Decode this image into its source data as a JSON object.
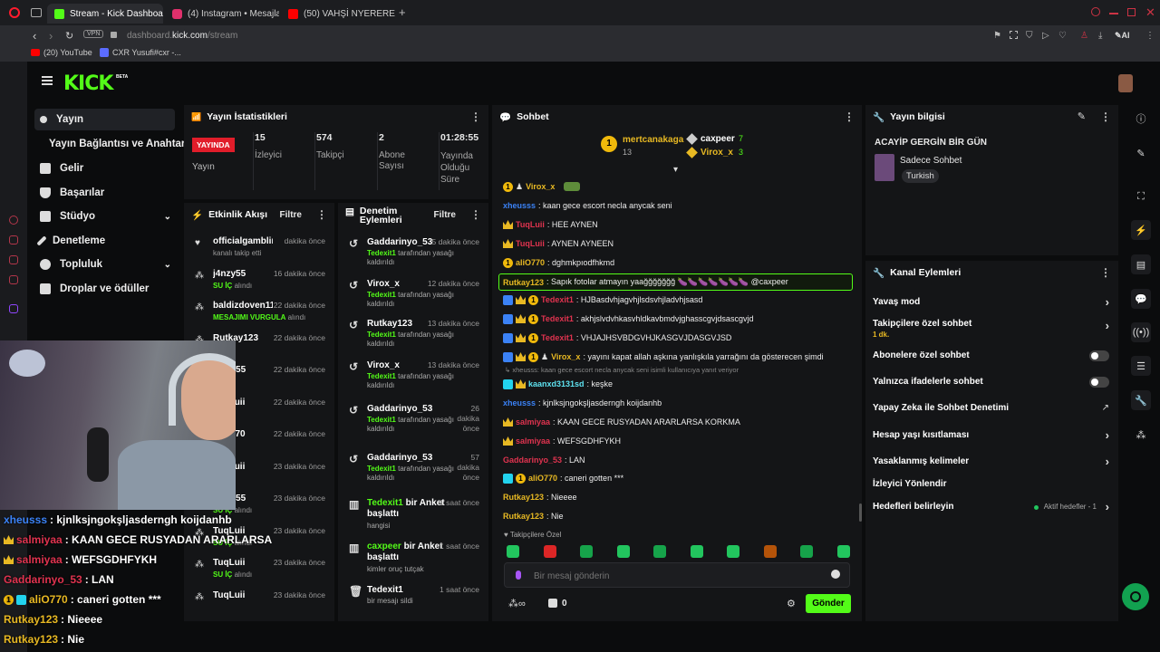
{
  "browser": {
    "tabs": [
      {
        "label": "Stream - Kick Dashboard",
        "color": "#53fc18"
      },
      {
        "label": "(4) Instagram • Mesajlar",
        "color": "#e1306c"
      },
      {
        "label": "(50) VAHŞİ NYERERE | En",
        "color": "#ff0000"
      }
    ],
    "vpn": "VPN",
    "url_host": "dashboard.",
    "url_domain": "kick.com",
    "url_path": "/stream",
    "ai_label": "AI",
    "bookmarks": [
      {
        "label": "(20) YouTube",
        "color": "#ff0000"
      },
      {
        "label": "CXR Yusufi#cxr -...",
        "color": "#5b6cff"
      }
    ]
  },
  "brand": {
    "logo": "KICK",
    "beta": "BETA"
  },
  "sidebar": {
    "items": [
      {
        "label": "Yayın",
        "icon": "broadcast-icon"
      },
      {
        "label": "Yayın Bağlantısı ve Anahtarı",
        "icon": ""
      },
      {
        "label": "Gelir",
        "icon": "chart-icon"
      },
      {
        "label": "Başarılar",
        "icon": "trophy-icon"
      },
      {
        "label": "Stüdyo",
        "icon": "studio-icon"
      },
      {
        "label": "Denetleme",
        "icon": "wrench-icon"
      },
      {
        "label": "Topluluk",
        "icon": "users-icon"
      },
      {
        "label": "Droplar ve ödüller",
        "icon": "gift-icon"
      }
    ]
  },
  "stats": {
    "title": "Yayın İstatistikleri",
    "live_badge": "YAYINDA",
    "live_label": "Yayın",
    "items": [
      {
        "value": "15",
        "label": "İzleyici"
      },
      {
        "value": "574",
        "label": "Takipçi"
      },
      {
        "value": "2",
        "label": "Abone Sayısı"
      },
      {
        "value": "01:28:55",
        "label": "Yayında Olduğu Süre"
      }
    ]
  },
  "activity": {
    "title": "Etkinlik Akışı",
    "filter": "Filtre",
    "items": [
      {
        "user": "officialgamblingacademy",
        "sub": "kanalı takip etti",
        "sub_green": "",
        "time": "dakika önce"
      },
      {
        "user": "j4nzy55",
        "sub": " alındı",
        "sub_green": "SU İÇ",
        "time": "16 dakika önce"
      },
      {
        "user": "baldizdoven11",
        "sub": " alındı",
        "sub_green": "MESAJIMI VURGULA",
        "time": "22 dakika önce"
      },
      {
        "user": "Rutkay123",
        "sub": "",
        "sub_green": "",
        "time": "22 dakika önce"
      },
      {
        "user": "j4nzy55",
        "sub": "",
        "sub_green": "",
        "time": "22 dakika önce"
      },
      {
        "user": "TuqLuii",
        "sub": "",
        "sub_green": "",
        "time": "22 dakika önce"
      },
      {
        "user": "aliO770",
        "sub": "",
        "sub_green": "",
        "time": "22 dakika önce"
      },
      {
        "user": "TuqLuii",
        "sub": "",
        "sub_green": "",
        "time": "23 dakika önce"
      },
      {
        "user": "j4nzy55",
        "sub": " alındı",
        "sub_green": "SU İÇ",
        "time": "23 dakika önce"
      },
      {
        "user": "TuqLuii",
        "sub": " alındı",
        "sub_green": "SU İÇ",
        "time": "23 dakika önce"
      },
      {
        "user": "TuqLuii",
        "sub": " alındı",
        "sub_green": "SU İÇ",
        "time": "23 dakika önce"
      },
      {
        "user": "TuqLuii",
        "sub": "",
        "sub_green": "",
        "time": "23 dakika önce"
      }
    ]
  },
  "moderation": {
    "title": "Denetim Eylemleri",
    "filter": "Filtre",
    "items": [
      {
        "user": "Gaddarinyo_53",
        "time": "5 dakika önce",
        "actor": "Tedexit1",
        "text": " tarafından yasağı kaldırıldı",
        "icon": "undo-icon"
      },
      {
        "user": "Virox_x",
        "time": "12 dakika önce",
        "actor": "Tedexit1",
        "text": " tarafından yasağı kaldırıldı",
        "icon": "undo-icon"
      },
      {
        "user": "Rutkay123",
        "time": "13 dakika önce",
        "actor": "Tedexit1",
        "text": " tarafından yasağı kaldırıldı",
        "icon": "undo-icon"
      },
      {
        "user": "Virox_x",
        "time": "13 dakika önce",
        "actor": "Tedexit1",
        "text": " tarafından yasağı kaldırıldı",
        "icon": "undo-icon"
      },
      {
        "user": "Gaddarinyo_53",
        "time": "26 dakika önce",
        "actor": "Tedexit1",
        "text": " tarafından yasağı kaldırıldı",
        "icon": "undo-icon"
      },
      {
        "user": "Gaddarinyo_53",
        "time": "57 dakika önce",
        "actor": "Tedexit1",
        "text": " tarafından yasağı kaldırıldı",
        "icon": "undo-icon"
      },
      {
        "user": "Tedexit1",
        "user_suffix": " bir Anket başlattı",
        "time": "1 saat önce",
        "actor": "",
        "text": "hangisi",
        "icon": "poll-icon"
      },
      {
        "user": "caxpeer",
        "user_suffix": " bir Anket başlattı",
        "time": "1 saat önce",
        "actor": "",
        "text": "kimler oruç tutçak",
        "icon": "poll-icon"
      },
      {
        "user": "Tedexit1",
        "time": "1 saat önce",
        "actor": "",
        "text": "bir mesajı sildi",
        "icon": "trash-icon"
      }
    ]
  },
  "chat": {
    "title": "Sohbet",
    "leaders": {
      "first": {
        "name": "mertcanakaga",
        "count": "13"
      },
      "second": {
        "name": "caxpeer",
        "count": "7"
      },
      "third": {
        "name": "Virox_x",
        "count": "3"
      }
    },
    "messages": [
      {
        "user": "Virox_x",
        "color": "#e8b923",
        "text": "",
        "badges": [
          "coin",
          "user"
        ],
        "emote": true
      },
      {
        "user": "xheusss",
        "color": "#3b82f6",
        "text": ": kaan gece escort necla anycak seni",
        "badges": []
      },
      {
        "user": "TuqLuii",
        "color": "#e0334f",
        "text": ": HEE AYNEN",
        "badges": [
          "crown"
        ]
      },
      {
        "user": "TuqLuii",
        "color": "#e0334f",
        "text": ": AYNEN AYNEEN",
        "badges": [
          "crown"
        ]
      },
      {
        "user": "aliO770",
        "color": "#e8b923",
        "text": ": dghmkpıodfhkmd",
        "badges": [
          "coin"
        ]
      },
      {
        "user": "Rutkay123",
        "color": "#e8b923",
        "text": ": Sapık fotolar atmayın yaağğğğğğğ 🍆🍆🍆🍆🍆🍆🍆 @caxpeer",
        "badges": [],
        "highlight": true
      },
      {
        "user": "Tedexit1",
        "color": "#e0334f",
        "text": ": HJBasdvhjagvhjlsdsvhjladvhjsasd",
        "badges": [
          "swords",
          "crown",
          "coin"
        ]
      },
      {
        "user": "Tedexit1",
        "color": "#e0334f",
        "text": ": akhjslvdvhkasvhldkavbmdvjghasscgvjdsascgvjd",
        "badges": [
          "swords",
          "crown",
          "coin"
        ]
      },
      {
        "user": "Tedexit1",
        "color": "#e0334f",
        "text": ": VHJAJHSVBDGVHJKASGVJDASGVJSD",
        "badges": [
          "swords",
          "crown",
          "coin"
        ]
      },
      {
        "user": "Virox_x",
        "color": "#e8b923",
        "text": ": yayını kapat allah aşkına yanlışkıla yarrağını da gösterecen şimdi",
        "badges": [
          "swords",
          "crown",
          "coin",
          "user"
        ]
      },
      {
        "user": "kaanxd3131sd",
        "color": "#5ee2f0",
        "text": ": keşke",
        "badges": [
          "teal",
          "crown"
        ],
        "reply": "↳ xheusss: kaan gece escort necla anycak seni isimli kullanıcıya yanıt veriyor"
      },
      {
        "user": "xheusss",
        "color": "#3b82f6",
        "text": ": kjnlksjngokşljasderngh koijdanhb",
        "badges": []
      },
      {
        "user": "salmiyaa",
        "color": "#e0334f",
        "text": ": KAAN GECE RUSYADAN ARARLARSA KORKMA",
        "badges": [
          "crown"
        ]
      },
      {
        "user": "salmiyaa",
        "color": "#e0334f",
        "text": ": WEFSGDHFYKH",
        "badges": [
          "crown"
        ]
      },
      {
        "user": "Gaddarinyo_53",
        "color": "#e0334f",
        "text": ": LAN",
        "badges": []
      },
      {
        "user": "aliO770",
        "color": "#e8b923",
        "text": ": caneri gotten ***",
        "badges": [
          "teal",
          "coin"
        ]
      },
      {
        "user": "Rutkay123",
        "color": "#e8b923",
        "text": ": Nieeee",
        "badges": []
      },
      {
        "user": "Rutkay123",
        "color": "#e8b923",
        "text": ": Nie",
        "badges": []
      }
    ],
    "followers_only": "Takipçilere Özel",
    "emote_colors": [
      "#22c55e",
      "#dc2626",
      "#16a34a",
      "#22c55e",
      "#16a34a",
      "#22c55e",
      "#22c55e",
      "#b45309",
      "#16a34a",
      "#22c55e"
    ],
    "input_placeholder": "Bir mesaj gönderin",
    "points": "0",
    "send": "Gönder"
  },
  "stream_info": {
    "title": "Yayın bilgisi",
    "stream_title": "ACAYİP GERGİN BİR GÜN",
    "category": "Sadece Sohbet",
    "language": "Turkish"
  },
  "channel_actions": {
    "title": "Kanal Eylemleri",
    "items": [
      {
        "label": "Yavaş mod",
        "control": "chevron"
      },
      {
        "label": "Takipçilere özel sohbet",
        "sub": "1 dk.",
        "control": "chevron"
      },
      {
        "label": "Abonelere özel sohbet",
        "control": "toggle"
      },
      {
        "label": "Yalnızca ifadelerle sohbet",
        "control": "toggle"
      },
      {
        "label": "Yapay Zeka ile Sohbet Denetimi",
        "control": "external"
      },
      {
        "label": "Hesap yaşı kısıtlaması",
        "control": "chevron"
      },
      {
        "label": "Yasaklanmış kelimeler",
        "control": "chevron"
      },
      {
        "label": "İzleyici Yönlendir",
        "control": "none"
      },
      {
        "label": "Hedefleri belirleyin",
        "control": "chevron",
        "extra": "Aktif hedefler - 1"
      }
    ]
  },
  "overlay_chat": [
    {
      "user": "xheusss",
      "color": "#3b82f6",
      "text": ": kjnlksjngokşljasderngh koijdanhb",
      "badges": []
    },
    {
      "user": "salmiyaa",
      "color": "#e0334f",
      "text": ": KAAN GECE RUSYADAN ARARLARSA",
      "badges": [
        "crown"
      ]
    },
    {
      "user": "salmiyaa",
      "color": "#e0334f",
      "text": ": WEFSGDHFYKH",
      "badges": [
        "crown"
      ]
    },
    {
      "user": "Gaddarinyo_53",
      "color": "#e0334f",
      "text": ": LAN",
      "badges": []
    },
    {
      "user": "aliO770",
      "color": "#e8b923",
      "text": ": caneri gotten ***",
      "badges": [
        "coin",
        "teal"
      ]
    },
    {
      "user": "Rutkay123",
      "color": "#e8b923",
      "text": ": Nieeee",
      "badges": []
    },
    {
      "user": "Rutkay123",
      "color": "#e8b923",
      "text": ": Nie",
      "badges": []
    }
  ]
}
